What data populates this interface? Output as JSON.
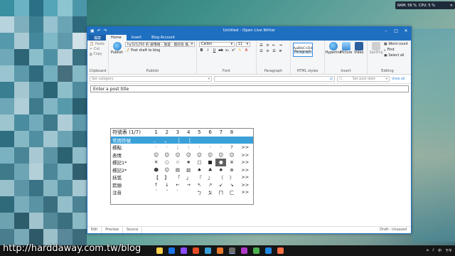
{
  "desktop": {
    "mosaic_colors": [
      "#3a8fa0",
      "#6bb3c4",
      "#2b6f84",
      "#54a5b7",
      "#8cc5cf",
      "#4c96a9",
      "#b7d3de",
      "#7faebd",
      "#3d7f93",
      "#97c2cf",
      "#6aa5b5",
      "#2e6a7d",
      "#5599ac",
      "#a9c9d4",
      "#43889c",
      "#7fb8c6",
      "#5e9aac",
      "#d1e1e8",
      "#6fa9b9",
      "#2d6577",
      "#8bbecb",
      "#4f91a4",
      "#b4d0da",
      "#386f81",
      "#9ac4d0",
      "#5b99ab",
      "#2f6b7e",
      "#74afbf",
      "#466f7d",
      "#86b9c6",
      "#3a7e91",
      "#a3c6d1",
      "#5f9cae",
      "#2b6677",
      "#8dbfcb",
      "#4d8b9d",
      "#6ea7b7",
      "#b0ced8",
      "#3c7a8c",
      "#82b6c4",
      "#579aac",
      "#2a5f6f",
      "#9cc5d0",
      "#4a8c9f",
      "#72abbb",
      "#3e7a8c",
      "#aecdd7",
      "#5e9aab",
      "#2f6d80",
      "#85b8c5",
      "#4f8fa1",
      "#9fc6d1",
      "#6aa3b3",
      "#346f80",
      "#7bb2c1",
      "#4a8597",
      "#a8c9d3",
      "#5b94a5",
      "#2c6373",
      "#8fbcc8",
      "#3f7a8b",
      "#6da5b4",
      "#b3d0d9",
      "#4b8799",
      "#7eb3c1",
      "#315f6f",
      "#98c1cc",
      "#5d95a6",
      "#3a7385",
      "#88b8c4",
      "#4e8a9b",
      "#a5c7d1",
      "#2f6a7b",
      "#7aadbb",
      "#5a93a4",
      "#3a6f80",
      "#92bfca",
      "#4b8294",
      "#6da2b1",
      "#2d5c6b",
      "#a0c3cd",
      "#54899a",
      "#3b7080",
      "#8ab8c3",
      "#4a7e8f",
      "#77a9b7",
      "#2e5969",
      "#9bc0ca",
      "#58889a",
      "#3c6c7c"
    ],
    "tray_top": {
      "ram": "RAM: 56 %",
      "cpu": "CPU: 5 %",
      "close": "✕"
    },
    "watermark": "http://harddaway.com.tw/blog"
  },
  "window": {
    "title": "Untitled - Open Live Writer",
    "tabs": [
      {
        "label": "檔案"
      },
      {
        "label": "Home"
      },
      {
        "label": "Insert"
      },
      {
        "label": "Blog Account"
      }
    ],
    "ribbon": {
      "clipboard": {
        "paste": "Paste",
        "cut": "Cut",
        "copy": "Copy",
        "label": "Clipboard"
      },
      "publish": {
        "publish": "Publish",
        "blog": "hy321250 的 部落格 - 放遊 · 資訊及 換...",
        "draft": "Post draft to blog",
        "label": "Publish"
      },
      "font": {
        "family": "Calibri",
        "size": "11",
        "label": "Font"
      },
      "paragraph": {
        "label": "Paragraph"
      },
      "html_styles": {
        "preview": "AaBbCcDd",
        "name": "Paragraph",
        "label": "HTML styles"
      },
      "insert": {
        "hyperlink": "Hyperlink",
        "picture": "Picture",
        "video": "Video",
        "label": "Insert"
      },
      "editing": {
        "spelling": "Spelling",
        "word_count": "Word count",
        "find": "Find",
        "select_all": "Select all",
        "label": "Editing"
      }
    },
    "category_placeholder": "Set category",
    "tags_placeholder": "",
    "date_placeholder": "Set post date",
    "view_all": "View all",
    "post_title_placeholder": "Enter a post title",
    "bottom_tabs": [
      {
        "label": "Edit"
      },
      {
        "label": "Preview"
      },
      {
        "label": "Source"
      }
    ],
    "status": "Draft - Unsaved"
  },
  "symbol_table": {
    "header": [
      "符號表 (1/7)",
      "1",
      "2",
      "3",
      "4",
      "5",
      "6",
      "7",
      "8",
      ""
    ],
    "rows": [
      [
        "常用符號",
        "、",
        "。",
        "［",
        "［",
        "",
        "",
        "",
        "",
        ""
      ],
      [
        "標點",
        "·",
        "·",
        ";",
        ":",
        "·",
        "·",
        "·",
        "?",
        ">>"
      ],
      [
        "表情",
        "☺",
        "☺",
        "☺",
        "☺",
        "☺",
        "☺",
        "☺",
        "☺",
        ">>"
      ],
      [
        "標記1*",
        "✕",
        "○",
        "☆",
        "★",
        "□",
        "■",
        "●",
        "※",
        ">>"
      ],
      [
        "標記2*",
        "☻",
        "☺",
        "▤",
        "▥",
        "♠",
        "♣",
        "♠",
        "⊕",
        ">>"
      ],
      [
        "括弧",
        "【",
        "】",
        "「",
        "」",
        "『",
        "』",
        "〈",
        "〉",
        ">>"
      ],
      [
        "箭頭",
        "↑",
        "↓",
        "←",
        "→",
        "↖",
        "↗",
        "↙",
        "↘",
        ">>"
      ],
      [
        "注音",
        "ˊ",
        "ˇ",
        "ˋ",
        "˙",
        "ㄅ",
        "ㄆ",
        "ㄇ",
        "ㄈ",
        ">>"
      ]
    ]
  },
  "taskbar": {
    "icons": [
      "#ffd04a",
      "#1a73e8",
      "#8a4dff",
      "#e44d26",
      "#3aa0d8",
      "#e8792d",
      "#6b6b6b",
      "#b03ac8",
      "#4caf50",
      "#1e88e5",
      "#ff7043"
    ],
    "tray": {
      "lang": "中",
      "time": "下午"
    }
  }
}
